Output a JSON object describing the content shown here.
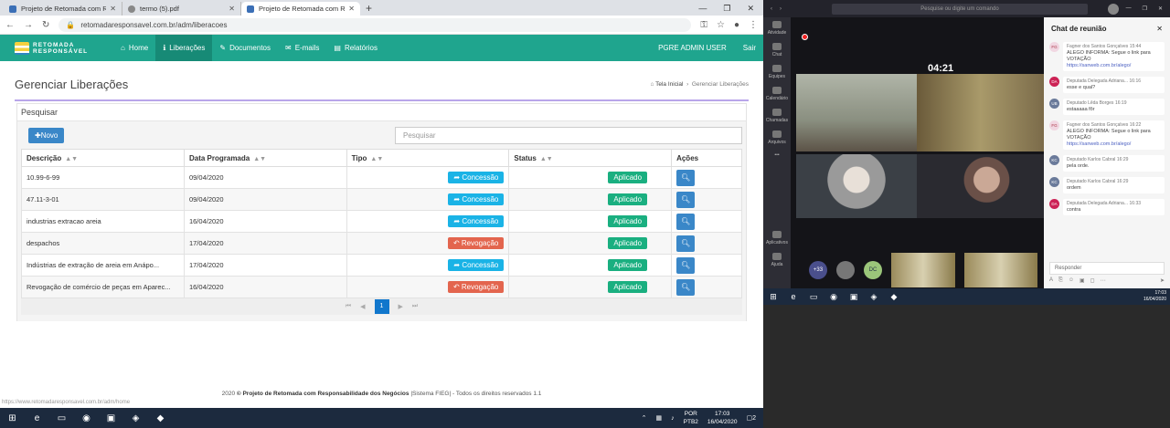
{
  "browser": {
    "tabs": [
      {
        "label": "Projeto de Retomada com Respo",
        "active": false
      },
      {
        "label": "termo (5).pdf",
        "active": false
      },
      {
        "label": "Projeto de Retomada com Respo",
        "active": true
      }
    ],
    "url": "retomadaresponsavel.com.br/adm/liberacoes"
  },
  "header": {
    "logo_line1": "RETOMADA",
    "logo_line2": "RESPONSÁVEL",
    "menu": [
      {
        "label": "Home",
        "icon": "home-icon"
      },
      {
        "label": "Liberações",
        "icon": "info-icon",
        "active": true
      },
      {
        "label": "Documentos",
        "icon": "edit-icon"
      },
      {
        "label": "E-mails",
        "icon": "mail-icon"
      },
      {
        "label": "Relatórios",
        "icon": "book-icon"
      }
    ],
    "user": "PGRE ADMIN USER",
    "logout": "Sair"
  },
  "page": {
    "title": "Gerenciar Liberações",
    "breadcrumb_home": "Tela Inicial",
    "breadcrumb_current": "Gerenciar Liberações",
    "panel_title": "Pesquisar",
    "new_button": "Novo",
    "search_placeholder": "Pesquisar"
  },
  "table": {
    "columns": [
      "Descrição",
      "Data Programada",
      "Tipo",
      "Status",
      "Ações"
    ],
    "rows": [
      {
        "descricao": "10.99-6-99",
        "data": "09/04/2020",
        "tipo": "Concessão",
        "status": "Aplicado"
      },
      {
        "descricao": "47.11-3-01",
        "data": "09/04/2020",
        "tipo": "Concessão",
        "status": "Aplicado"
      },
      {
        "descricao": "industrias extracao areia",
        "data": "16/04/2020",
        "tipo": "Concessão",
        "status": "Aplicado"
      },
      {
        "descricao": "despachos",
        "data": "17/04/2020",
        "tipo": "Revogação",
        "status": "Aplicado"
      },
      {
        "descricao": "Indústrias de extração de areia em Anápo...",
        "data": "17/04/2020",
        "tipo": "Concessão",
        "status": "Aplicado"
      },
      {
        "descricao": "Revogação de comércio de peças em Aparec...",
        "data": "16/04/2020",
        "tipo": "Revogação",
        "status": "Aplicado"
      }
    ],
    "current_page": "1"
  },
  "footer": {
    "year": "2020",
    "brand": "© Projeto de Retomada com Responsabilidade dos Negócios",
    "rest": "|Sistema FIEG| - Todos os direitos reservados 1.1",
    "status_url": "https://www.retomadaresponsavel.com.br/adm/home"
  },
  "taskbar": {
    "lang1": "POR",
    "lang2": "PTB2",
    "time": "17:03",
    "date": "16/04/2020",
    "notif": "2"
  },
  "teams": {
    "search": "Pesquise ou digite um comando",
    "rail": [
      "Atividade",
      "Chat",
      "Equipes",
      "Calendário",
      "Chamadas",
      "Arquivos",
      "Aplicativos",
      "Ajuda"
    ],
    "timer": "04:21",
    "extra_count": "+33",
    "dc": "DC",
    "chat_title": "Chat de reunião",
    "reply_placeholder": "Responder",
    "messages": [
      {
        "initials": "FG",
        "name": "Fagner dos Santos Gonçalves",
        "time": "15:44",
        "text": "ALEGO INFORMA: Segue o link para VOTAÇÃO",
        "link": "https://sanweb.com.br/alego/"
      },
      {
        "initials": "DA",
        "name": "Deputada Delegada Adriana...",
        "time": "16:16",
        "text": "esse e qual?",
        "link": ""
      },
      {
        "initials": "UB",
        "name": "Deputado Lêda Borges",
        "time": "16:19",
        "text": "estaaaaa fôr",
        "link": ""
      },
      {
        "initials": "FG",
        "name": "Fagner dos Santos Gonçalves",
        "time": "16:22",
        "text": "ALEGO INFORMA: Segue o link para VOTAÇÃO",
        "link": "https://sanweb.com.br/alego/"
      },
      {
        "initials": "KC",
        "name": "Deputado Karlos Cabral",
        "time": "16:29",
        "text": "pela orde.",
        "link": ""
      },
      {
        "initials": "KC",
        "name": "Deputado Karlos Cabral",
        "time": "16:29",
        "text": "ordem",
        "link": ""
      },
      {
        "initials": "DA",
        "name": "Deputada Delegada Adriana...",
        "time": "16:33",
        "text": "contra",
        "link": ""
      }
    ],
    "time": "17:03",
    "date": "16/04/2020"
  }
}
